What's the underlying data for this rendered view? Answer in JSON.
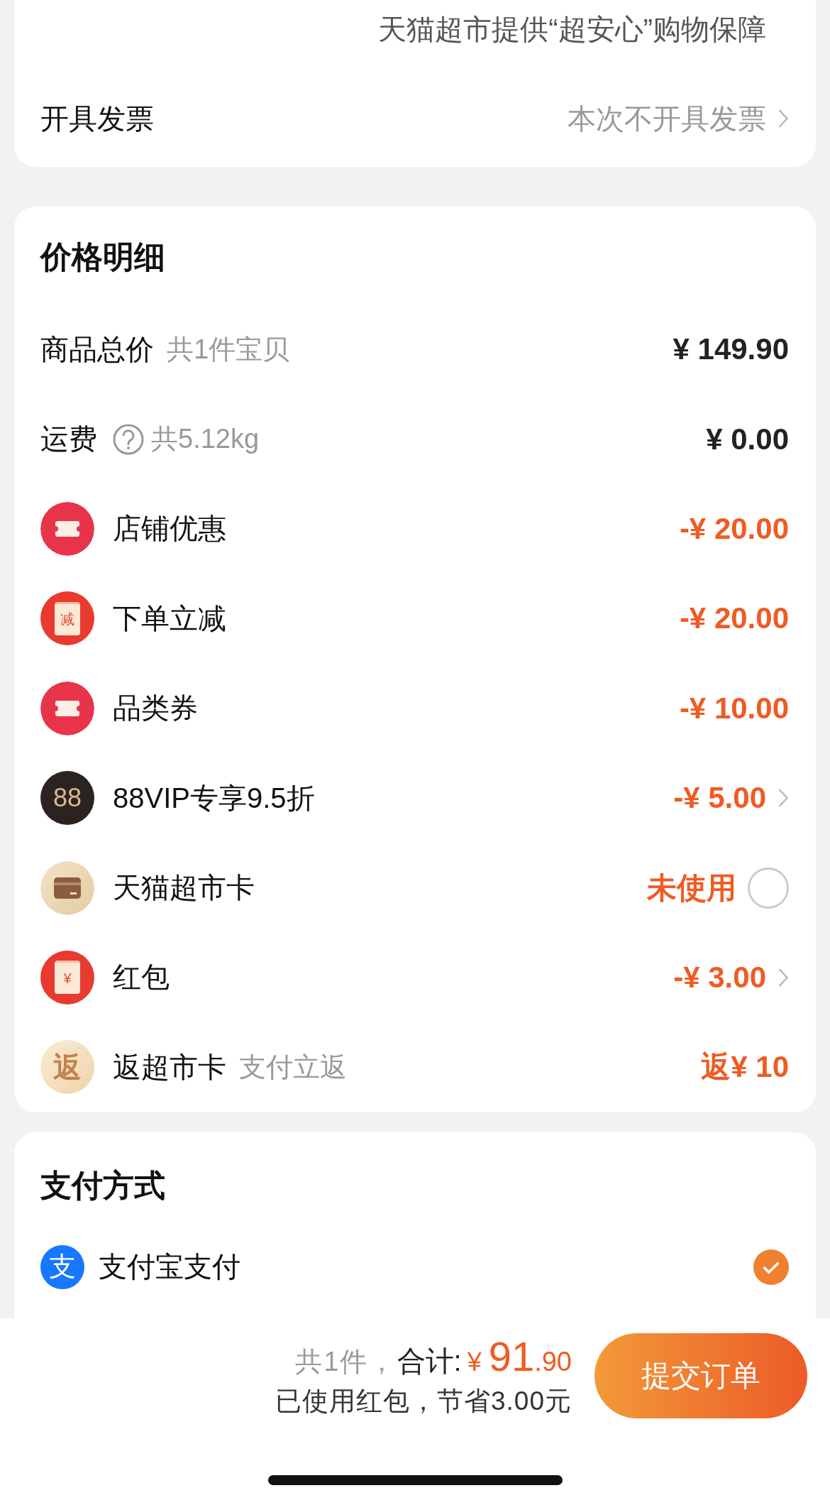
{
  "delivery_card": {
    "rows": [
      {
        "value": "天猫超市提供“超安心”购物保障"
      },
      {
        "label": "开具发票",
        "value": "本次不开具发票"
      }
    ]
  },
  "price_details": {
    "title": "价格明细",
    "rows": [
      {
        "kind": "subtotal",
        "label": "商品总价",
        "note": "共1件宝贝",
        "value": "¥ 149.90",
        "chevron": false
      },
      {
        "kind": "shipping",
        "label": "运费",
        "note": "共5.12kg",
        "value": "¥ 0.00",
        "chevron": false
      },
      {
        "kind": "coupon",
        "label": "店铺优惠",
        "value": "-¥ 20.00",
        "chevron": false
      },
      {
        "kind": "envelope",
        "icon_text": "减",
        "label": "下单立减",
        "value": "-¥ 20.00",
        "chevron": false
      },
      {
        "kind": "coupon",
        "label": "品类券",
        "value": "-¥ 10.00",
        "chevron": false
      },
      {
        "kind": "vip",
        "icon_text": "88",
        "label": "88VIP专享9.5折",
        "value": "-¥ 5.00",
        "chevron": true
      },
      {
        "kind": "card",
        "label": "天猫超市卡",
        "value": "未使用",
        "checked": false
      },
      {
        "kind": "envelope",
        "icon_text": "¥",
        "label": "红包",
        "value": "-¥ 3.00",
        "chevron": true
      },
      {
        "kind": "rebate",
        "icon_text": "返",
        "label": "返超市卡",
        "note": "支付立返",
        "value": "返¥ 10",
        "chevron": false
      }
    ]
  },
  "payment": {
    "title": "支付方式",
    "methods": [
      {
        "icon_text": "支",
        "label": "支付宝支付",
        "selected": true
      }
    ]
  },
  "footer": {
    "count": "共1件，",
    "total_label": "合计:",
    "currency": "¥",
    "total_int": "91",
    "total_dec": ".90",
    "savings": "已使用红包，节省3.00元",
    "submit": "提交订单"
  }
}
